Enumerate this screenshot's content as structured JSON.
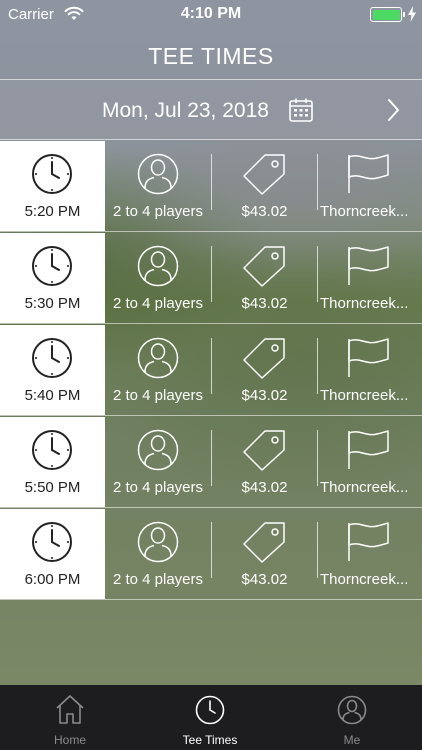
{
  "status_bar": {
    "carrier": "Carrier",
    "time": "4:10 PM",
    "battery_color": "#4cd964"
  },
  "header": {
    "title": "TEE TIMES"
  },
  "date_bar": {
    "date": "Mon, Jul 23, 2018",
    "calendar_icon": "calendar-icon",
    "next_icon": "chevron-right-icon"
  },
  "tee_times": [
    {
      "time": "5:20 PM",
      "players": "2 to 4 players",
      "price": "$43.02",
      "course": "Thorncreek..."
    },
    {
      "time": "5:30 PM",
      "players": "2 to 4 players",
      "price": "$43.02",
      "course": "Thorncreek..."
    },
    {
      "time": "5:40 PM",
      "players": "2 to 4 players",
      "price": "$43.02",
      "course": "Thorncreek..."
    },
    {
      "time": "5:50 PM",
      "players": "2 to 4 players",
      "price": "$43.02",
      "course": "Thorncreek..."
    },
    {
      "time": "6:00 PM",
      "players": "2 to 4 players",
      "price": "$43.02",
      "course": "Thorncreek..."
    }
  ],
  "tab_bar": {
    "tabs": [
      {
        "label": "Home",
        "icon": "home-icon"
      },
      {
        "label": "Tee Times",
        "icon": "clock-icon",
        "active": true
      },
      {
        "label": "Me",
        "icon": "person-icon"
      }
    ]
  }
}
